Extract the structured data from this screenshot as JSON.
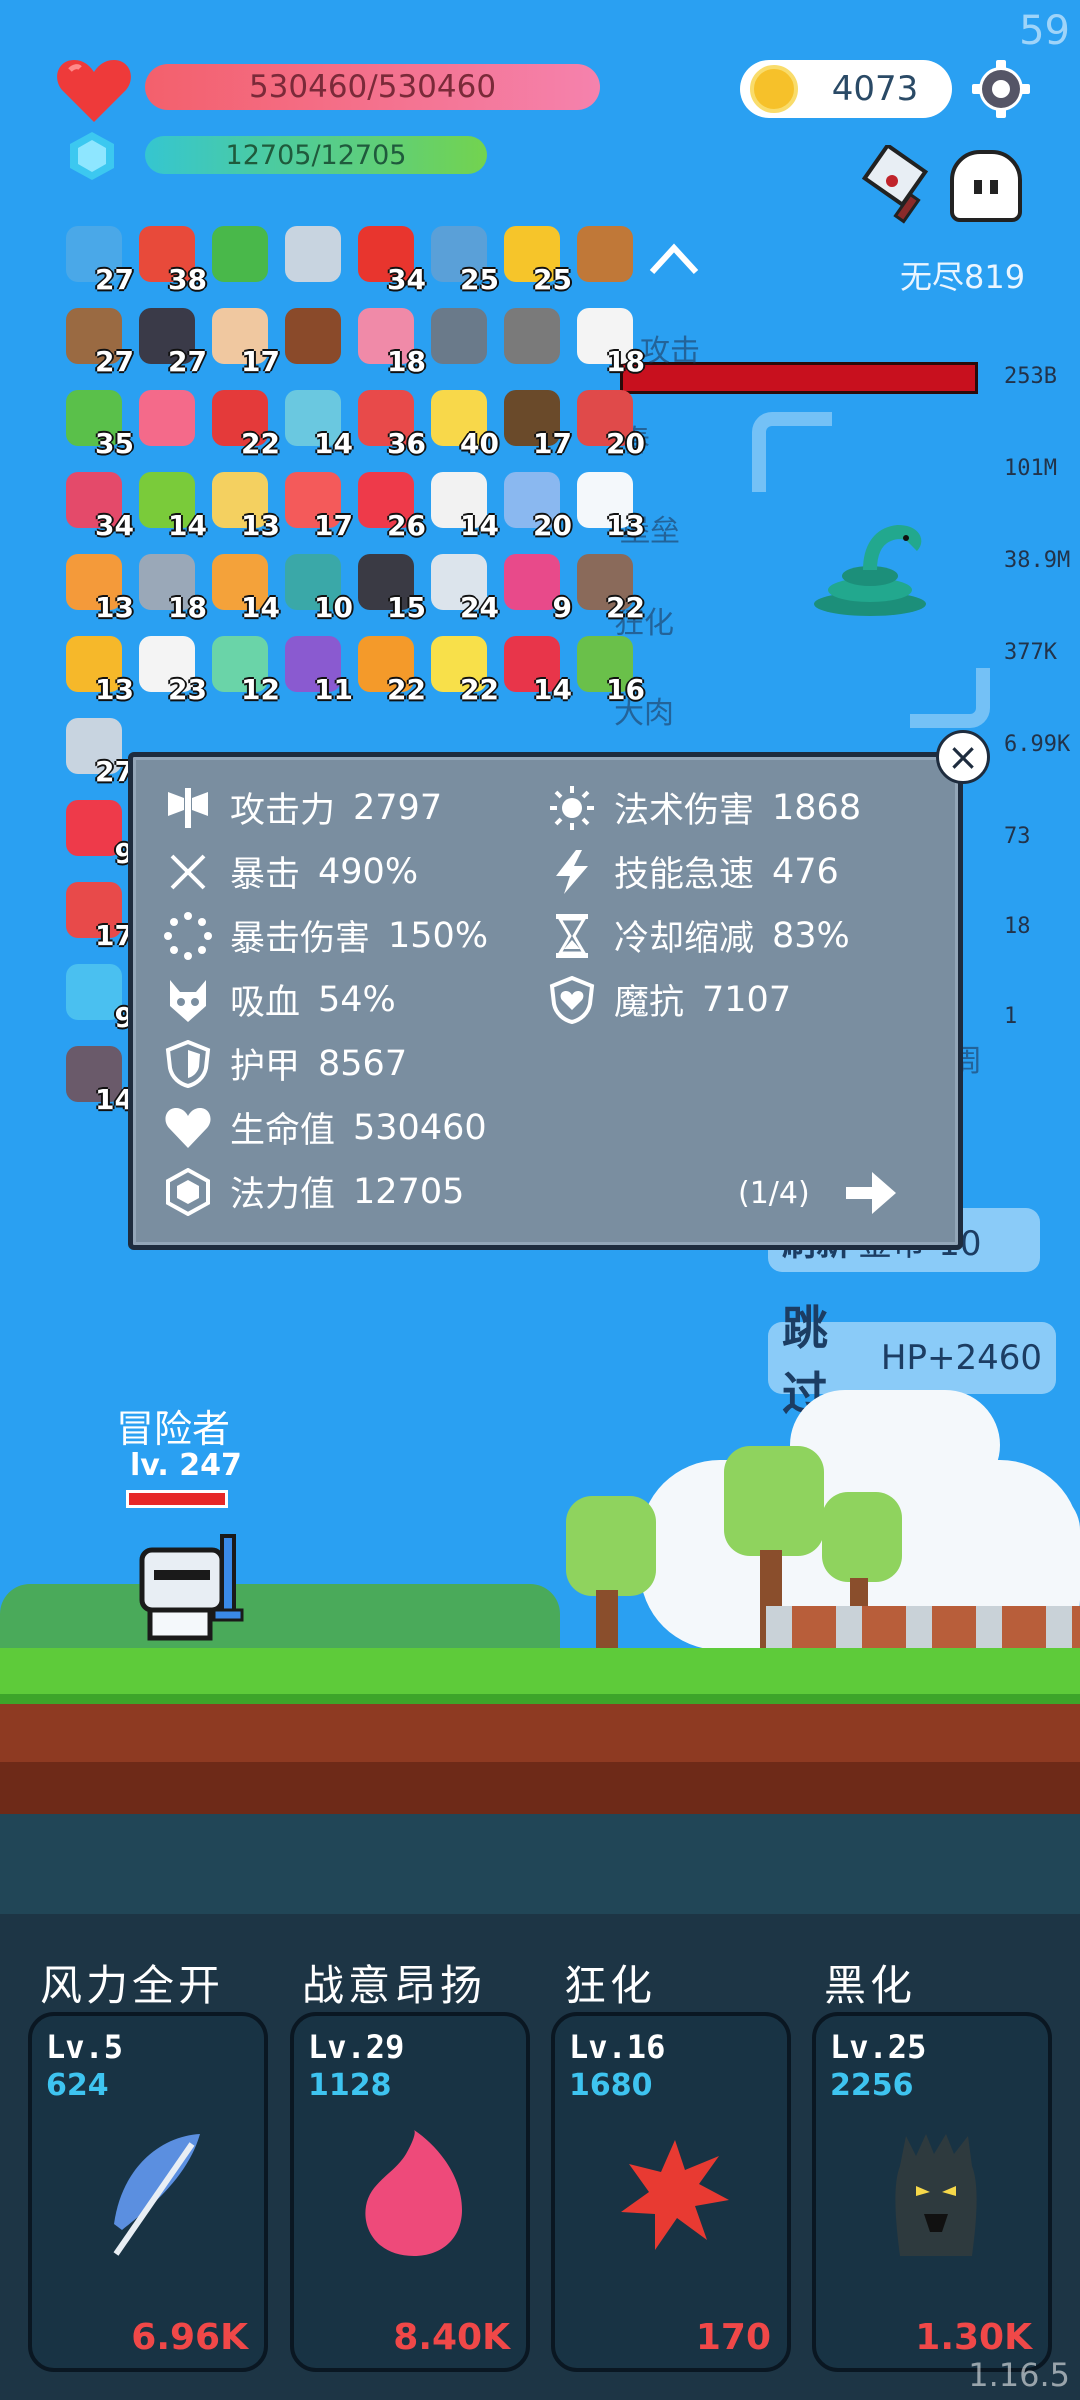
{
  "fps": "59",
  "version": "1.16.5",
  "hp": "530460/530460",
  "mp": "12705/12705",
  "coins": "4073",
  "mode": "无尽819",
  "inventory": [
    {
      "icon": "star-card-icon",
      "count": "27",
      "color": "#4aa8e8"
    },
    {
      "icon": "sock-icon",
      "count": "38",
      "color": "#e84a3a"
    },
    {
      "icon": "green-book-icon",
      "count": "",
      "color": "#49b84a"
    },
    {
      "icon": "sword-icon",
      "count": "",
      "color": "#c8d4e0"
    },
    {
      "icon": "apple-icon",
      "count": "34",
      "color": "#e8352e"
    },
    {
      "icon": "shield-icon",
      "count": "25",
      "color": "#5aa0d8"
    },
    {
      "icon": "crown-icon",
      "count": "25",
      "color": "#f6c52a"
    },
    {
      "icon": "drumstick-icon",
      "count": "",
      "color": "#c07838"
    },
    {
      "icon": "wood-shield-icon",
      "count": "27",
      "color": "#9a6a42"
    },
    {
      "icon": "bat-icon",
      "count": "27",
      "color": "#3a3a48"
    },
    {
      "icon": "fist-icon",
      "count": "17",
      "color": "#f0c8a0"
    },
    {
      "icon": "mushroom-icon",
      "count": "",
      "color": "#8a4a2a"
    },
    {
      "icon": "ice-cream-icon",
      "count": "18",
      "color": "#f08aa8"
    },
    {
      "icon": "mortar-icon",
      "count": "",
      "color": "#6a7a8a"
    },
    {
      "icon": "helmet-icon",
      "count": "",
      "color": "#7a7a7a"
    },
    {
      "icon": "cards-icon",
      "count": "18",
      "color": "#f4f4f4"
    },
    {
      "icon": "money-heart-icon",
      "count": "35",
      "color": "#5ac04a"
    },
    {
      "icon": "love-letter-icon",
      "count": "",
      "color": "#f46a8a"
    },
    {
      "icon": "red-mushroom-icon",
      "count": "22",
      "color": "#e43a3a"
    },
    {
      "icon": "potion-cat-icon",
      "count": "14",
      "color": "#6ac8e0"
    },
    {
      "icon": "watermelon-icon",
      "count": "36",
      "color": "#e84a4a"
    },
    {
      "icon": "lightbulb-icon",
      "count": "40",
      "color": "#f8d84a"
    },
    {
      "icon": "coconut-icon",
      "count": "17",
      "color": "#6a4a2a"
    },
    {
      "icon": "red-shield-icon",
      "count": "20",
      "color": "#e04a4a"
    },
    {
      "icon": "jam-jar-icon",
      "count": "34",
      "color": "#e44a6a"
    },
    {
      "icon": "lime-icon",
      "count": "14",
      "color": "#7acb3a"
    },
    {
      "icon": "note-pencil-icon",
      "count": "13",
      "color": "#f4d060"
    },
    {
      "icon": "pill-icon",
      "count": "17",
      "color": "#f45a5a"
    },
    {
      "icon": "heart-item-icon",
      "count": "26",
      "color": "#ee3a4a"
    },
    {
      "icon": "dice-icon",
      "count": "14",
      "color": "#f2f2f2"
    },
    {
      "icon": "blue-capsule-icon",
      "count": "20",
      "color": "#8ab8f0"
    },
    {
      "icon": "cloud-item-icon",
      "count": "13",
      "color": "#f4f8fb"
    },
    {
      "icon": "flag-icon",
      "count": "13",
      "color": "#f49a3a"
    },
    {
      "icon": "elephant-icon",
      "count": "18",
      "color": "#9aa8b8"
    },
    {
      "icon": "meteor-icon",
      "count": "14",
      "color": "#f4a23a"
    },
    {
      "icon": "portal-ring-icon",
      "count": "10",
      "color": "#3aa8a8"
    },
    {
      "icon": "piggy-bank-icon",
      "count": "15",
      "color": "#3a3a44"
    },
    {
      "icon": "clipboard-icon",
      "count": "24",
      "color": "#dce4ec"
    },
    {
      "icon": "hook-icon",
      "count": "9",
      "color": "#e84a8a"
    },
    {
      "icon": "tombstone-icon",
      "count": "22",
      "color": "#8a6a5a"
    },
    {
      "icon": "sunflower-icon",
      "count": "13",
      "color": "#f6b82a"
    },
    {
      "icon": "flower-icon",
      "count": "23",
      "color": "#f4f4f4"
    },
    {
      "icon": "green-slime-icon",
      "count": "12",
      "color": "#6ad4a8"
    },
    {
      "icon": "purple-shield-icon",
      "count": "11",
      "color": "#8a5ad0"
    },
    {
      "icon": "orange-book-icon",
      "count": "22",
      "color": "#f49a2a"
    },
    {
      "icon": "fried-egg-icon",
      "count": "22",
      "color": "#f8e04a"
    },
    {
      "icon": "strawberry-icon",
      "count": "14",
      "color": "#e8354a"
    },
    {
      "icon": "green-goblin-icon",
      "count": "16",
      "color": "#6ac04a"
    },
    {
      "icon": "sword-small-icon",
      "count": "27",
      "color": "#c8d4e0"
    },
    {
      "icon": "heart-small-icon",
      "count": "9",
      "color": "#ee3a4a"
    },
    {
      "icon": "thermometer-icon",
      "count": "17",
      "color": "#e84a4a"
    },
    {
      "icon": "chat-bubble-icon",
      "count": "9",
      "color": "#4ac0f0"
    },
    {
      "icon": "frame-icon",
      "count": "14",
      "color": "#6a5a6a"
    }
  ],
  "boss_labels": [
    "攻击",
    "春",
    "堡垒",
    "狂化",
    "大肉",
    "周"
  ],
  "right_values": [
    "253B",
    "101M",
    "38.9M",
    "377K",
    "6.99K",
    "73",
    "18",
    "1"
  ],
  "refresh": {
    "label": "刷新",
    "cost": "金币-10"
  },
  "skip": {
    "label": "跳过",
    "bonus": "HP+2460"
  },
  "stats_popup": {
    "close": "×",
    "left": [
      {
        "icon": "axe-icon",
        "name": "攻击力",
        "value": "2797"
      },
      {
        "icon": "crit-icon",
        "name": "暴击",
        "value": "490%"
      },
      {
        "icon": "crit-damage-icon",
        "name": "暴击伤害",
        "value": "150%"
      },
      {
        "icon": "lifesteal-icon",
        "name": "吸血",
        "value": "54%"
      },
      {
        "icon": "armor-icon",
        "name": "护甲",
        "value": "8567"
      },
      {
        "icon": "heart-icon",
        "name": "生命值",
        "value": "530460"
      },
      {
        "icon": "mana-gem-icon",
        "name": "法力值",
        "value": "12705"
      }
    ],
    "right": [
      {
        "icon": "sun-icon",
        "name": "法术伤害",
        "value": "1868"
      },
      {
        "icon": "lightning-icon",
        "name": "技能急速",
        "value": "476"
      },
      {
        "icon": "hourglass-icon",
        "name": "冷却缩减",
        "value": "83%"
      },
      {
        "icon": "magic-resist-icon",
        "name": "魔抗",
        "value": "7107"
      }
    ],
    "page": "(1/4)"
  },
  "player": {
    "name": "冒险者",
    "level": "lv. 247"
  },
  "skills": [
    {
      "title": "风力全开",
      "level": "Lv.5",
      "cost": "624",
      "damage": "6.96K",
      "icon": "feather-icon",
      "color": "#5b8fe0"
    },
    {
      "title": "战意昂扬",
      "level": "Lv.29",
      "cost": "1128",
      "damage": "8.40K",
      "icon": "flame-icon",
      "color": "#ee4a7a"
    },
    {
      "title": "狂化",
      "level": "Lv.16",
      "cost": "1680",
      "damage": "170",
      "icon": "splat-icon",
      "color": "#e83a32"
    },
    {
      "title": "黑化",
      "level": "Lv.25",
      "cost": "2256",
      "damage": "1.30K",
      "icon": "dark-tree-icon",
      "color": "#2e3a3e"
    }
  ]
}
